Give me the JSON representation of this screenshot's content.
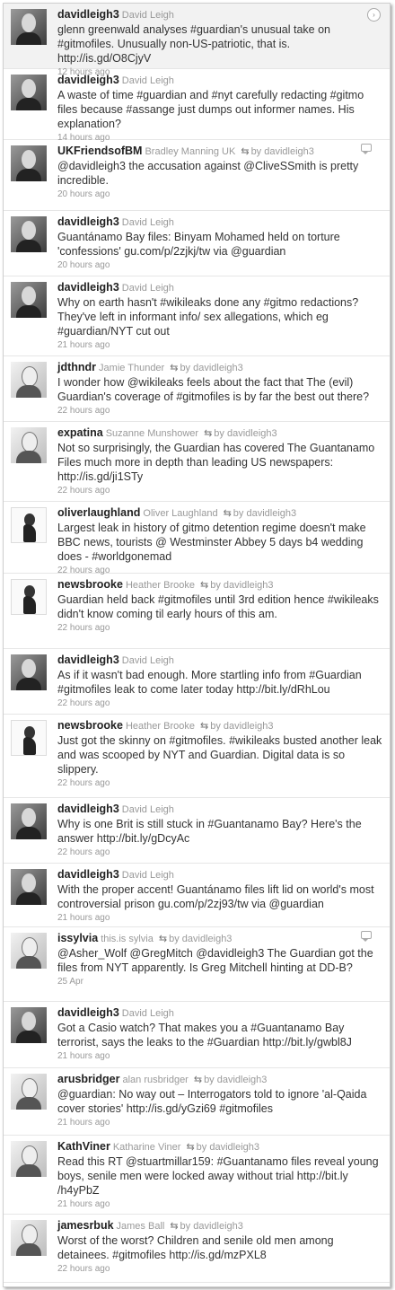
{
  "tweets": [
    {
      "handle": "davidleigh3",
      "realname": "David Leigh",
      "rt_by": "",
      "text": "glenn greenwald analyses #guardian's unusual take on #gitmofiles. Unusually non-US-patriotic, that is. http://is.gd/O8CjyV",
      "time": "12 hours ago",
      "icon": "arrow-icon"
    },
    {
      "handle": "davidleigh3",
      "realname": "David Leigh",
      "rt_by": "",
      "text": "A waste of time #guardian and #nyt carefully redacting #gitmo files because #assange just dumps out informer names. His explanation?",
      "time": "14 hours ago",
      "icon": ""
    },
    {
      "handle": "UKFriendsofBM",
      "realname": "Bradley Manning UK",
      "rt_by": "by davidleigh3",
      "text": "@davidleigh3 the accusation against @CliveSSmith is pretty incredible.",
      "time": "20 hours ago",
      "icon": "reply-icon"
    },
    {
      "handle": "davidleigh3",
      "realname": "David Leigh",
      "rt_by": "",
      "text": "Guantánamo Bay files: Binyam Mohamed held on torture 'confessions' gu.com/p/2zjkj/tw via @guardian",
      "time": "20 hours ago",
      "icon": ""
    },
    {
      "handle": "davidleigh3",
      "realname": "David Leigh",
      "rt_by": "",
      "text": "Why on earth hasn't #wikileaks done any #gitmo redactions? They've left in informant info/ sex allegations, which eg #guardian/NYT cut out",
      "time": "21 hours ago",
      "icon": ""
    },
    {
      "handle": "jdthndr",
      "realname": "Jamie Thunder",
      "rt_by": "by davidleigh3",
      "text": "I wonder how @wikileaks feels about the fact that The (evil) Guardian's coverage of #gitmofiles is by far the best out there?",
      "time": "22 hours ago",
      "icon": ""
    },
    {
      "handle": "expatina",
      "realname": "Suzanne Munshower",
      "rt_by": "by davidleigh3",
      "text": "Not so surprisingly, the Guardian has covered The Guantanamo Files much more in depth than leading US newspapers: http://is.gd/ji1STy",
      "time": "22 hours ago",
      "icon": ""
    },
    {
      "handle": "oliverlaughland",
      "realname": "Oliver Laughland",
      "rt_by": "by davidleigh3",
      "text": "Largest leak in history of gitmo detention regime doesn't make BBC news, tourists @ Westminster Abbey 5 days b4 wedding does - #worldgonemad",
      "time": "22 hours ago",
      "icon": ""
    },
    {
      "handle": "newsbrooke",
      "realname": "Heather Brooke",
      "rt_by": "by davidleigh3",
      "text": "Guardian held back #gitmofiles until 3rd edition hence #wikileaks didn't know coming til early hours of this am.",
      "time": "22 hours ago",
      "icon": ""
    },
    {
      "handle": "davidleigh3",
      "realname": "David Leigh",
      "rt_by": "",
      "text": "As if it wasn't bad enough. More startling info from #Guardian #gitmofiles leak to come later today http://bit.ly/dRhLou",
      "time": "22 hours ago",
      "icon": ""
    },
    {
      "handle": "newsbrooke",
      "realname": "Heather Brooke",
      "rt_by": "by davidleigh3",
      "text": "Just got the skinny on #gitmofiles. #wikileaks busted another leak and was scooped by NYT and Guardian. Digital data is so slippery.",
      "time": "22 hours ago",
      "icon": ""
    },
    {
      "handle": "davidleigh3",
      "realname": "David Leigh",
      "rt_by": "",
      "text": "Why is one Brit is still stuck in #Guantanamo Bay? Here's the answer http://bit.ly/gDcyAc",
      "time": "22 hours ago",
      "icon": ""
    },
    {
      "handle": "davidleigh3",
      "realname": "David Leigh",
      "rt_by": "",
      "text": "With the proper accent! Guantánamo files lift lid on world's most controversial prison gu.com/p/2zj93/tw via @guardian",
      "time": "21 hours ago",
      "icon": ""
    },
    {
      "handle": "issylvia",
      "realname": "this.is sylvia",
      "rt_by": "by davidleigh3",
      "text": "@Asher_Wolf @GregMitch @davidleigh3 The Guardian got the files from NYT apparently. Is Greg Mitchell hinting at DD-B?",
      "time": "25 Apr",
      "icon": "reply-icon"
    },
    {
      "handle": "davidleigh3",
      "realname": "David Leigh",
      "rt_by": "",
      "text": "Got a Casio watch? That makes you a #Guantanamo Bay terrorist, says the leaks to the #Guardian http://bit.ly/gwbl8J",
      "time": "21 hours ago",
      "icon": ""
    },
    {
      "handle": "arusbridger",
      "realname": "alan rusbridger",
      "rt_by": "by davidleigh3",
      "text": "@guardian: No way out – Interrogators told to ignore 'al-Qaida cover stories' http://is.gd/yGzi69 #gitmofiles",
      "time": "21 hours ago",
      "icon": ""
    },
    {
      "handle": "KathViner",
      "realname": "Katharine Viner",
      "rt_by": "by davidleigh3",
      "text": "Read this RT @stuartmillar159: #Guantanamo files reveal young boys, senile men were locked away without trial http://bit.ly /h4yPbZ",
      "time": "21 hours ago",
      "icon": ""
    },
    {
      "handle": "jamesrbuk",
      "realname": "James Ball",
      "rt_by": "by davidleigh3",
      "text": "Worst of the worst? Children and senile old men among detainees. #gitmofiles http://is.gd/mzPXL8",
      "time": "22 hours ago",
      "icon": ""
    }
  ]
}
